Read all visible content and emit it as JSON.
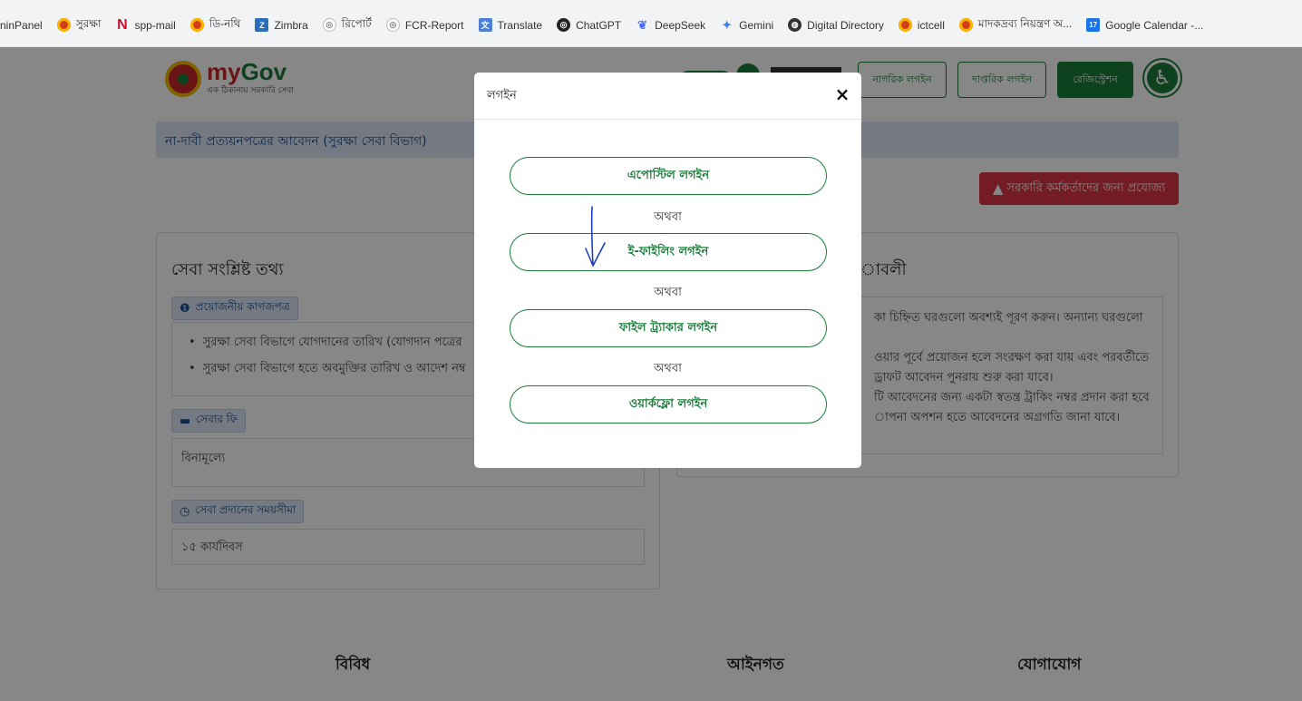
{
  "bookmarks": [
    {
      "icon": "adminpanel-icon",
      "label": "ninPanel"
    },
    {
      "icon": "gov-logo-icon",
      "label": "সুরক্ষা"
    },
    {
      "icon": "n-mail-icon",
      "label": "spp-mail"
    },
    {
      "icon": "gov-logo-icon",
      "label": "ডি-নথি"
    },
    {
      "icon": "zimbra-icon",
      "label": "Zimbra"
    },
    {
      "icon": "report-icon",
      "label": "রিপোর্ট"
    },
    {
      "icon": "report-icon",
      "label": "FCR-Report"
    },
    {
      "icon": "translate-icon",
      "label": "Translate"
    },
    {
      "icon": "chatgpt-icon",
      "label": "ChatGPT"
    },
    {
      "icon": "deepseek-icon",
      "label": "DeepSeek"
    },
    {
      "icon": "gemini-icon",
      "label": "Gemini"
    },
    {
      "icon": "globe-icon",
      "label": "Digital Directory"
    },
    {
      "icon": "gov-logo-icon",
      "label": "ictcell"
    },
    {
      "icon": "gov-logo-icon",
      "label": "মাদকদ্রব্য নিয়ন্ত্রণ অ..."
    },
    {
      "icon": "calendar-icon",
      "label": "Google Calendar -..."
    }
  ],
  "header": {
    "logo_my": "my",
    "logo_gov": "Gov",
    "logo_tagline": "এক ঠিকানায় সরকারি সেবা",
    "citizen_login": "নাগরিক লগইন",
    "office_login": "দাপ্তরিক লগইন",
    "registration": "রেজিস্ট্রেশন"
  },
  "page": {
    "title": "না-দাবী প্রত্যয়নপত্রের আবেদন (সুরক্ষা সেবা বিভাগ)",
    "warning": "সরকারি কর্মকর্তাদের জন্য প্রযোজ্য"
  },
  "service_info": {
    "heading": "সেবা সংশ্লিষ্ট তথ্য",
    "docs_label": "প্রয়োজনীয় কাগজপত্র",
    "docs": [
      "সুরক্ষা সেবা বিভাগে যোগদানের তারিখ (যোগদান পত্রের",
      "সুরক্ষা সেবা বিভাগে হতে অবমুক্তির তারিখ ও আদেশ নম্ব"
    ],
    "fee_label": "সেবার ফি",
    "fee_value": "বিনামূল্যে",
    "time_label": "সেবা প্রদানের সময়সীমা",
    "time_value": "১৫ কার্যদিবস"
  },
  "rules": {
    "heading": "াবলী",
    "lines": [
      "কা চিহ্নিত ঘরগুলো অবশ্যই পূরণ করুন। অন্যান্য ঘরগুলো",
      "",
      "ওয়ার পূর্বে প্রয়োজন হলে সংরক্ষণ করা যায় এবং পরবর্তীতে",
      "ড্রাফট আবেদন পুনরায় শুরু করা যাবে।",
      "টি আবেদনের জন্য একটা স্বতন্ত্র ট্রাকিং নম্বর প্রদান করা হবে",
      "াপনা অপশন হতে আবেদনের অগ্রগতি জানা যাবে।"
    ]
  },
  "footer": {
    "misc": "বিবিধ",
    "legal": "আইনগত",
    "contact": "যোগাযোগ"
  },
  "modal": {
    "title": "লগইন",
    "close": "×",
    "buttons": [
      "এপোস্টিল লগইন",
      "ই-ফাইলিং লগইন",
      "ফাইল ট্র্যাকার লগইন",
      "ওয়ার্কফ্লো লগইন"
    ],
    "or": "অথবা"
  },
  "colors": {
    "brand_green": "#1b7c3a",
    "warning_red": "#dc3545",
    "annotation_blue": "#1f3fbf"
  }
}
